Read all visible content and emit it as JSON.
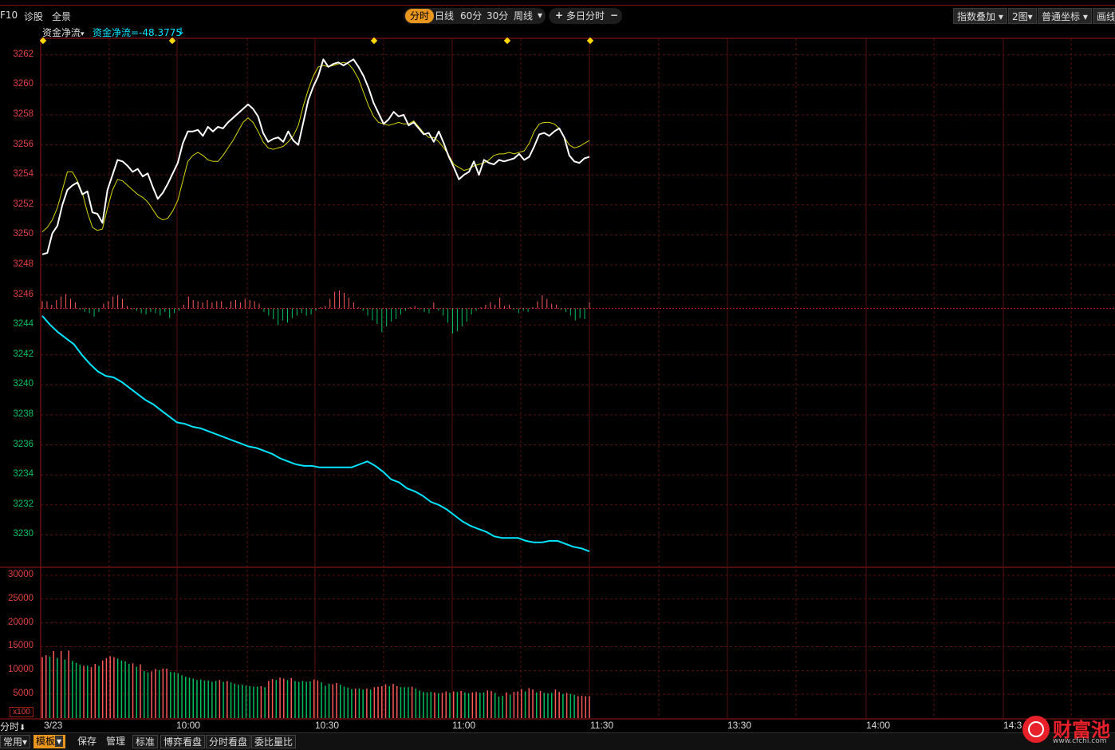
{
  "topbar": {
    "f10": "F10",
    "zhengu": "诊股",
    "quanjing": "全景",
    "period_tabs": [
      "分时",
      "日线",
      "60分",
      "30分",
      "周线"
    ],
    "period_active": 0,
    "plus_icon": "plus-icon",
    "multiday": "多日分时",
    "minus_icon": "minus-icon",
    "index_overlay": "指数叠加",
    "chart_count": "2图",
    "coord": "普通坐标",
    "draw": "画线"
  },
  "indicator": {
    "name": "资金净流",
    "readout": "资金净流=-48.3775",
    "arrow": "↓"
  },
  "colors": {
    "price": "#ffffff",
    "avg": "#d8d800",
    "flow": "#00e5ff",
    "up": "#ff5a5a",
    "down": "#00c060",
    "grid": "#5a1010",
    "axis_red": "#e04040",
    "axis_green": "#00c060"
  },
  "chart_data": [
    {
      "type": "line",
      "title": "",
      "ylim": [
        3228,
        3263
      ],
      "yticks": [
        3262,
        3260,
        3258,
        3256,
        3254,
        3252,
        3250,
        3248,
        3246,
        3244,
        3242,
        3240,
        3238,
        3236,
        3234,
        3232,
        3230
      ],
      "ytick_up": [
        3262,
        3260,
        3258,
        3256,
        3254,
        3252,
        3250,
        3248,
        3246
      ],
      "ytick_down": [
        3244,
        3242,
        3240,
        3238,
        3236,
        3234,
        3232,
        3230
      ],
      "prev_close": 3245.1,
      "minutes_total": 240,
      "series": [
        {
          "kind": "price",
          "values": [
            3248.7,
            3248.8,
            3250.1,
            3250.6,
            3252.0,
            3253.0,
            3253.3,
            3253.5,
            3252.7,
            3252.9,
            3251.5,
            3251.4,
            3250.8,
            3253.0,
            3254.0,
            3255.0,
            3254.9,
            3254.6,
            3254.2,
            3254.4,
            3253.9,
            3254.1,
            3253.2,
            3252.4,
            3252.8,
            3253.4,
            3254.1,
            3254.8,
            3256.1,
            3256.9,
            3256.9,
            3257.0,
            3256.6,
            3257.2,
            3256.9,
            3257.2,
            3257.1,
            3257.5,
            3257.8,
            3258.1,
            3258.4,
            3258.7,
            3258.4,
            3257.9,
            3256.8,
            3256.2,
            3256.4,
            3256.5,
            3256.2,
            3256.9,
            3256.3,
            3256.0,
            3257.5,
            3259.0,
            3259.9,
            3260.6,
            3261.7,
            3261.2,
            3261.4,
            3261.5,
            3261.3,
            3261.5,
            3261.7,
            3261.2,
            3260.6,
            3259.8,
            3258.8,
            3258.1,
            3257.4,
            3257.7,
            3258.2,
            3257.9,
            3258.0,
            3257.3,
            3257.5,
            3257.1,
            3256.7,
            3256.8,
            3256.2,
            3256.9,
            3256.1,
            3255.2,
            3254.5,
            3253.7,
            3254.0,
            3254.2,
            3254.9,
            3254.0,
            3255.0,
            3254.8,
            3254.7,
            3255.0,
            3254.9,
            3255.0,
            3255.1,
            3255.4,
            3255.0,
            3255.2,
            3255.9,
            3256.7,
            3256.8,
            3256.6,
            3256.9,
            3257.1,
            3256.5,
            3255.3,
            3254.9,
            3254.8,
            3255.1,
            3255.2
          ]
        },
        {
          "kind": "avg",
          "values": [
            3250.2,
            3250.5,
            3251.0,
            3251.8,
            3253.0,
            3254.2,
            3254.2,
            3253.6,
            3252.8,
            3251.5,
            3250.5,
            3250.3,
            3250.4,
            3251.8,
            3253.0,
            3253.7,
            3253.6,
            3253.3,
            3253.0,
            3252.7,
            3252.5,
            3252.2,
            3251.7,
            3251.2,
            3251.0,
            3251.1,
            3251.6,
            3252.3,
            3253.6,
            3254.9,
            3255.3,
            3255.5,
            3255.3,
            3255.0,
            3254.9,
            3254.9,
            3255.3,
            3255.8,
            3256.3,
            3256.9,
            3257.5,
            3257.8,
            3257.5,
            3256.9,
            3256.2,
            3255.8,
            3255.7,
            3255.8,
            3255.9,
            3256.2,
            3256.6,
            3257.3,
            3258.6,
            3259.7,
            3260.6,
            3261.2,
            3261.3,
            3261.2,
            3261.3,
            3261.4,
            3261.5,
            3261.4,
            3261.0,
            3260.4,
            3259.5,
            3258.6,
            3257.9,
            3257.5,
            3257.4,
            3257.3,
            3257.4,
            3257.5,
            3257.4,
            3257.4,
            3257.6,
            3257.2,
            3256.8,
            3256.5,
            3256.5,
            3256.2,
            3255.8,
            3255.3,
            3254.7,
            3254.5,
            3254.3,
            3254.4,
            3254.6,
            3254.7,
            3254.8,
            3255.0,
            3255.3,
            3255.4,
            3255.4,
            3255.5,
            3255.4,
            3255.5,
            3255.6,
            3256.1,
            3256.9,
            3257.4,
            3257.5,
            3257.5,
            3257.4,
            3257.1,
            3256.5,
            3256.0,
            3255.8,
            3255.9,
            3256.1,
            3256.3
          ]
        },
        {
          "kind": "flow",
          "values": [
            3244.6,
            3244.0,
            3243.5,
            3243.1,
            3242.7,
            3242.0,
            3241.4,
            3240.9,
            3240.6,
            3240.5,
            3240.2,
            3239.8,
            3239.4,
            3239.0,
            3238.7,
            3238.3,
            3237.9,
            3237.5,
            3237.4,
            3237.2,
            3237.1,
            3236.9,
            3236.7,
            3236.5,
            3236.3,
            3236.1,
            3235.9,
            3235.8,
            3235.6,
            3235.4,
            3235.1,
            3234.9,
            3234.7,
            3234.6,
            3234.6,
            3234.5,
            3234.5,
            3234.5,
            3234.5,
            3234.5,
            3234.7,
            3234.9,
            3234.6,
            3234.2,
            3233.7,
            3233.5,
            3233.1,
            3232.9,
            3232.6,
            3232.2,
            3232.0,
            3231.7,
            3231.3,
            3230.9,
            3230.6,
            3230.4,
            3230.2,
            3229.9,
            3229.8,
            3229.8,
            3229.8,
            3229.6,
            3229.5,
            3229.5,
            3229.6,
            3229.6,
            3229.4,
            3229.2,
            3229.1,
            3228.9
          ]
        }
      ],
      "bar_values": [
        1.2,
        1.2,
        0.6,
        1.4,
        2.0,
        2.4,
        1.6,
        1.0,
        -0.2,
        -0.6,
        -0.8,
        -1.4,
        -0.6,
        0.8,
        1.2,
        2.0,
        2.2,
        1.6,
        0.4,
        -0.2,
        -0.4,
        -0.8,
        -1.0,
        -0.6,
        -0.8,
        -1.2,
        -0.6,
        -1.6,
        -0.8,
        -0.4,
        0.6,
        2.0,
        1.4,
        1.2,
        1.0,
        1.4,
        1.0,
        1.2,
        1.2,
        0.2,
        1.2,
        1.4,
        1.0,
        1.6,
        1.4,
        1.2,
        0.8,
        -0.6,
        -1.2,
        -1.8,
        -2.8,
        -2.0,
        -2.4,
        -1.6,
        -1.2,
        -0.8,
        -1.2,
        -1.0,
        -0.4,
        0.2,
        0.4,
        1.6,
        2.8,
        3.0,
        2.6,
        1.8,
        1.0,
        0.2,
        -0.4,
        -1.2,
        -2.0,
        -2.6,
        -4.0,
        -3.0,
        -2.2,
        -1.8,
        -1.0,
        -0.4,
        0.2,
        0.4,
        -0.2,
        -0.6,
        -0.8,
        1.0,
        -0.4,
        -1.2,
        -2.4,
        -4.2,
        -3.8,
        -3.0,
        -2.2,
        -1.0,
        -0.4,
        0.2,
        0.6,
        1.0,
        0.6,
        1.8,
        0.4,
        0.6,
        -0.2,
        -0.8,
        -0.4,
        -0.6,
        0.2,
        1.2,
        2.2,
        1.6,
        0.8,
        0.6,
        -0.2,
        -0.6,
        -1.2,
        -2.0,
        -1.6,
        -1.8,
        1.0
      ]
    },
    {
      "type": "bar",
      "title": "",
      "ylim": [
        0,
        31000
      ],
      "yticks": [
        30000,
        25000,
        20000,
        15000,
        10000,
        5000
      ],
      "unit": "x100",
      "values": [
        12800,
        13200,
        12900,
        14100,
        12600,
        14100,
        12300,
        14200,
        12000,
        11600,
        11200,
        11000,
        11000,
        10700,
        11400,
        11000,
        12100,
        12600,
        13000,
        12800,
        12500,
        12100,
        11900,
        11400,
        11500,
        10800,
        11300,
        9900,
        9600,
        9800,
        10300,
        10100,
        10400,
        10400,
        9700,
        9600,
        9400,
        9000,
        8700,
        8500,
        8300,
        8000,
        8100,
        7900,
        7900,
        7600,
        7800,
        8000,
        7600,
        7800,
        7500,
        7200,
        7000,
        7000,
        6800,
        6700,
        6600,
        6600,
        6700,
        6500,
        7800,
        8200,
        8000,
        8500,
        8300,
        8000,
        8400,
        7800,
        7600,
        7800,
        7600,
        7700,
        8100,
        7900,
        7500,
        6800,
        7200,
        7100,
        7400,
        7000,
        6600,
        6400,
        6100,
        6200,
        6200,
        6000,
        6200,
        6000,
        6500,
        6600,
        6700,
        7100,
        6700,
        7200,
        6700,
        6500,
        6500,
        6500,
        6600,
        6200,
        5800,
        5500,
        5400,
        5500,
        5400,
        5200,
        5300,
        5600,
        5300,
        5600,
        5500,
        5700,
        5400,
        5200,
        5400,
        5500,
        5300,
        5400,
        5800,
        5700,
        5300,
        4500,
        4700,
        5400,
        4900,
        5500,
        5600,
        6100,
        5600,
        6300,
        6000,
        5400,
        5700,
        5300,
        5200,
        5300,
        6000,
        5500,
        5100,
        5300,
        5100,
        4900,
        4600,
        4700,
        4600,
        4600
      ],
      "colors_up": [
        true,
        true,
        false,
        true,
        false,
        true,
        false,
        true,
        false,
        false,
        false,
        true,
        false,
        true,
        true,
        false,
        true,
        true,
        true,
        true,
        false,
        false,
        false,
        false,
        true,
        false,
        true,
        false,
        false,
        true,
        true,
        false,
        true,
        true,
        false,
        false,
        false,
        false,
        false,
        false,
        false,
        false,
        false,
        false,
        false,
        false,
        false,
        true,
        false,
        true,
        false,
        false,
        false,
        false,
        false,
        false,
        false,
        false,
        true,
        false,
        true,
        true,
        false,
        true,
        true,
        false,
        true,
        false,
        false,
        false,
        false,
        false,
        true,
        true,
        false,
        false,
        false,
        true,
        true,
        false,
        false,
        false,
        false,
        true,
        false,
        false,
        true,
        false,
        true,
        true,
        true,
        true,
        false,
        true,
        true,
        false,
        false,
        false,
        true,
        false,
        false,
        false,
        false,
        false,
        true,
        false,
        true,
        true,
        false,
        true,
        false,
        true,
        false,
        false,
        true,
        true,
        false,
        false,
        true,
        true,
        false,
        false,
        false,
        true,
        false,
        true,
        true,
        true,
        false,
        true,
        true,
        false,
        true,
        false,
        false,
        false,
        true,
        true,
        false,
        true,
        false,
        false,
        true,
        true,
        true,
        true
      ]
    }
  ],
  "xaxis": {
    "left_label": "分时",
    "labels": [
      "3/23",
      "10:00",
      "10:30",
      "11:00",
      "11:30",
      "13:30",
      "14:00",
      "14:3"
    ]
  },
  "bottombar": {
    "items": [
      "常用",
      "模板",
      "保存",
      "管理",
      "标准",
      "博弈看盘",
      "分时看盘",
      "委比量比"
    ]
  },
  "logo": {
    "text": "财富池",
    "url_text": "www.cfchi.com"
  }
}
